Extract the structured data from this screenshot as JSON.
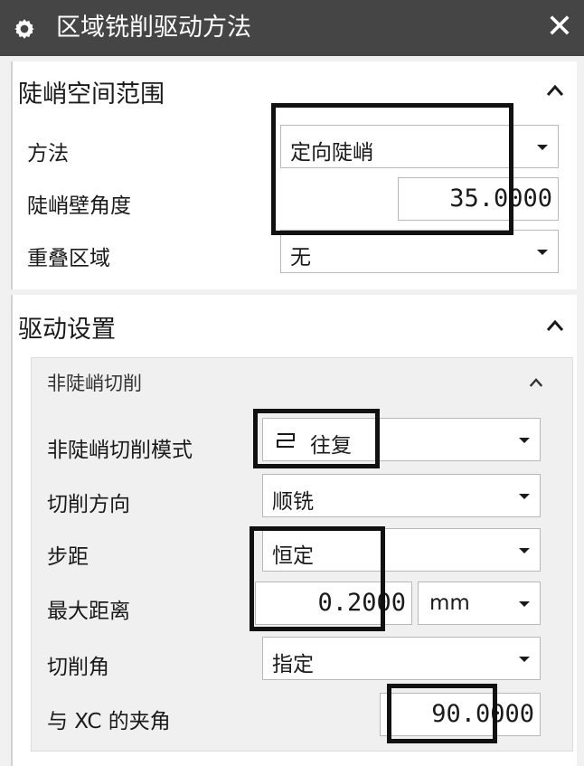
{
  "dialog": {
    "title": "区域铣削驱动方法",
    "icon": "gear-icon",
    "close_label": "✕"
  },
  "steep_section": {
    "title": "陡峭空间范围",
    "rows": {
      "method": {
        "label": "方法",
        "value": "定向陡峭"
      },
      "wall_angle": {
        "label": "陡峭壁角度",
        "value": "35.0000"
      },
      "overlap": {
        "label": "重叠区域",
        "value": "无"
      }
    }
  },
  "drive_section": {
    "title": "驱动设置",
    "sub": {
      "title": "非陡峭切削",
      "rows": {
        "pattern": {
          "label": "非陡峭切削模式",
          "value": "往复",
          "icon": "zigzag-pattern-icon"
        },
        "direction": {
          "label": "切削方向",
          "value": "顺铣"
        },
        "stepover": {
          "label": "步距",
          "value": "恒定"
        },
        "max_dist": {
          "label": "最大距离",
          "value": "0.2000",
          "unit": "mm"
        },
        "cut_angle": {
          "label": "切削角",
          "value": "指定"
        },
        "xc_angle": {
          "label": "与 XC 的夹角",
          "value": "90.0000"
        }
      }
    }
  },
  "colors": {
    "titlebar_bg": "#454545",
    "panel_bg": "#f1f1f1",
    "annotation_box": "#111111"
  }
}
